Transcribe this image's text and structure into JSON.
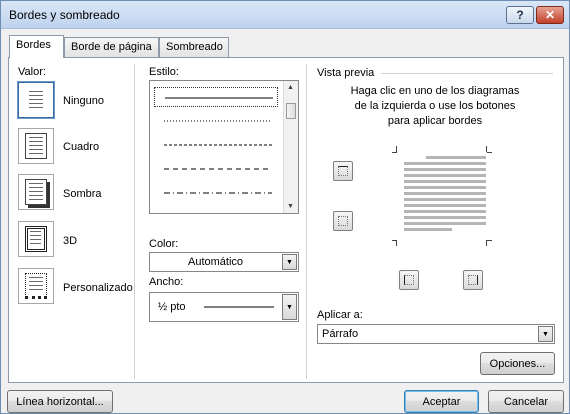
{
  "window": {
    "title": "Bordes y sombreado",
    "help_label": "?",
    "close_label": "✕"
  },
  "tabs": [
    {
      "label": "Bordes",
      "active": true
    },
    {
      "label": "Borde de página",
      "active": false
    },
    {
      "label": "Sombreado",
      "active": false
    }
  ],
  "valor": {
    "label": "Valor:",
    "options": [
      {
        "label": "Ninguno",
        "icon": "border-none-icon",
        "selected": true
      },
      {
        "label": "Cuadro",
        "icon": "border-box-icon",
        "selected": false
      },
      {
        "label": "Sombra",
        "icon": "border-shadow-icon",
        "selected": false
      },
      {
        "label": "3D",
        "icon": "border-3d-icon",
        "selected": false
      },
      {
        "label": "Personalizado",
        "icon": "border-custom-icon",
        "selected": false
      }
    ]
  },
  "estilo": {
    "label": "Estilo:",
    "styles": [
      "solid",
      "dotted",
      "dashed-small",
      "dashed",
      "dash-dot"
    ]
  },
  "color": {
    "label": "Color:",
    "value": "Automático"
  },
  "ancho": {
    "label": "Ancho:",
    "value": "½ pto"
  },
  "preview": {
    "label": "Vista previa",
    "hint": "Haga clic en uno de los diagramas de la izquierda o use los botones para aplicar bordes"
  },
  "aplicar": {
    "label": "Aplicar a:",
    "value": "Párrafo"
  },
  "buttons": {
    "opciones": "Opciones...",
    "linea_horizontal": "Línea horizontal...",
    "aceptar": "Aceptar",
    "cancelar": "Cancelar"
  },
  "colors": {
    "accent": "#3c7fb1",
    "close": "#c1402a"
  }
}
